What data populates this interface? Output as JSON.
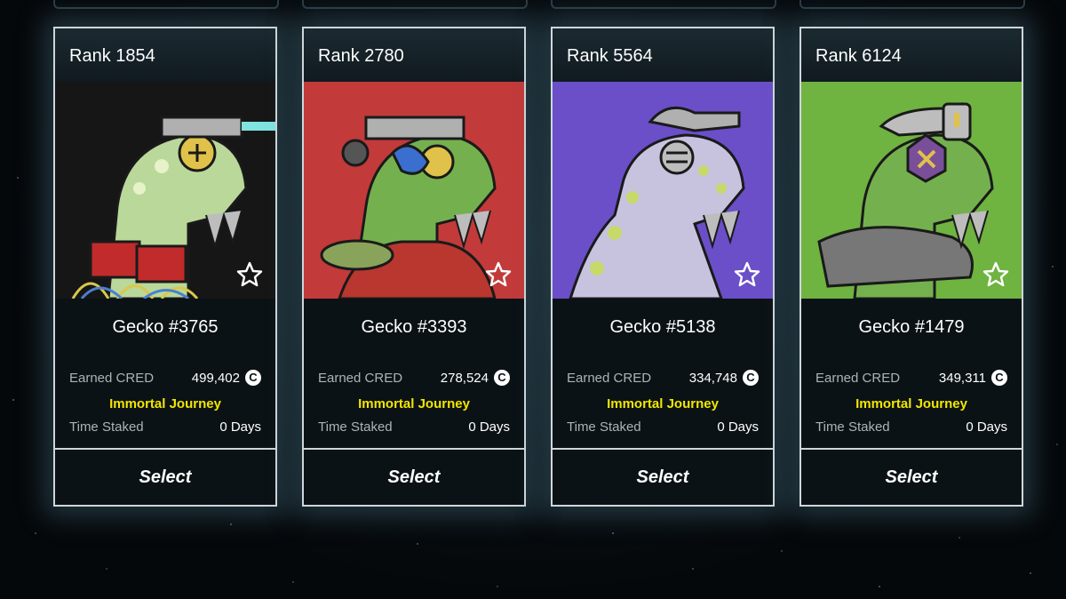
{
  "cards": [
    {
      "rank": "Rank 1854",
      "name": "Gecko #3765",
      "earned_label": "Earned CRED",
      "earned_value": "499,402",
      "status": "Immortal Journey",
      "staked_label": "Time Staked",
      "staked_value": "0 Days",
      "select_label": "Select",
      "art_bg": "#141414",
      "art_accent": "#c94b3a"
    },
    {
      "rank": "Rank 2780",
      "name": "Gecko #3393",
      "earned_label": "Earned CRED",
      "earned_value": "278,524",
      "status": "Immortal Journey",
      "staked_label": "Time Staked",
      "staked_value": "0 Days",
      "select_label": "Select",
      "art_bg": "#c23a3a",
      "art_accent": "#3a6fd0"
    },
    {
      "rank": "Rank 5564",
      "name": "Gecko #5138",
      "earned_label": "Earned CRED",
      "earned_value": "334,748",
      "status": "Immortal Journey",
      "staked_label": "Time Staked",
      "staked_value": "0 Days",
      "select_label": "Select",
      "art_bg": "#6a4fc8",
      "art_accent": "#c6d96a"
    },
    {
      "rank": "Rank 6124",
      "name": "Gecko #1479",
      "earned_label": "Earned CRED",
      "earned_value": "349,311",
      "status": "Immortal Journey",
      "staked_label": "Time Staked",
      "staked_value": "0 Days",
      "select_label": "Select",
      "art_bg": "#6fb340",
      "art_accent": "#7a4f9a"
    }
  ],
  "currency_symbol": "C",
  "colors": {
    "status": "#f2e600",
    "border": "#cfd6da",
    "card_bg": "#0b1216"
  }
}
